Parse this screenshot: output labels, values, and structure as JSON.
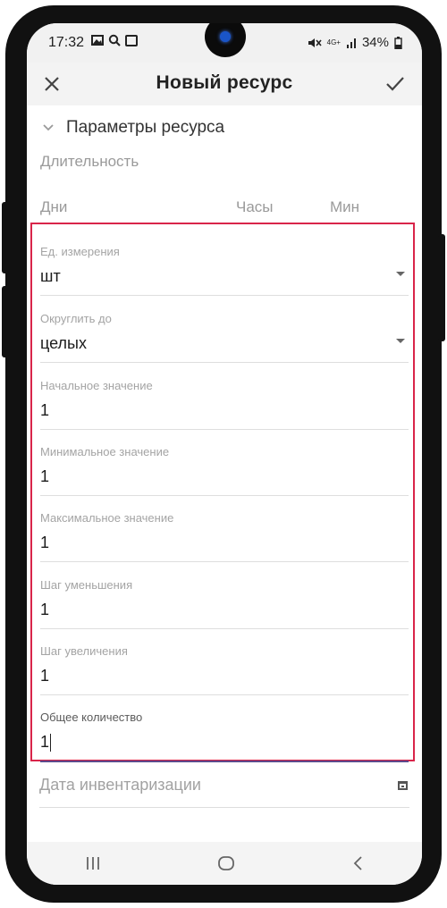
{
  "status_bar": {
    "time": "17:32",
    "battery": "34%",
    "net_label": "4G+"
  },
  "app_bar": {
    "title": "Новый ресурс"
  },
  "section": {
    "title": "Параметры ресурса",
    "duration_label": "Длительность",
    "days_label": "Дни",
    "hours_label": "Часы",
    "minutes_label": "Мин"
  },
  "fields": [
    {
      "label": "Ед. измерения",
      "value": "шт",
      "type": "select"
    },
    {
      "label": "Округлить до",
      "value": "целых",
      "type": "select"
    },
    {
      "label": "Начальное значение",
      "value": "1",
      "type": "text"
    },
    {
      "label": "Минимальное значение",
      "value": "1",
      "type": "text"
    },
    {
      "label": "Максимальное значение",
      "value": "1",
      "type": "text"
    },
    {
      "label": "Шаг уменьшения",
      "value": "1",
      "type": "text"
    },
    {
      "label": "Шаг увеличения",
      "value": "1",
      "type": "text"
    },
    {
      "label": "Общее количество",
      "value": "1",
      "type": "text",
      "focused": true
    }
  ],
  "inventory": {
    "placeholder": "Дата инвентаризации"
  },
  "icons": {
    "close": "close-icon",
    "save": "check-icon",
    "section_toggle": "chevron-down-icon",
    "date": "calendar-icon"
  },
  "colors": {
    "highlight_border": "#d9254a",
    "focus_underline": "#5c4a8c"
  }
}
